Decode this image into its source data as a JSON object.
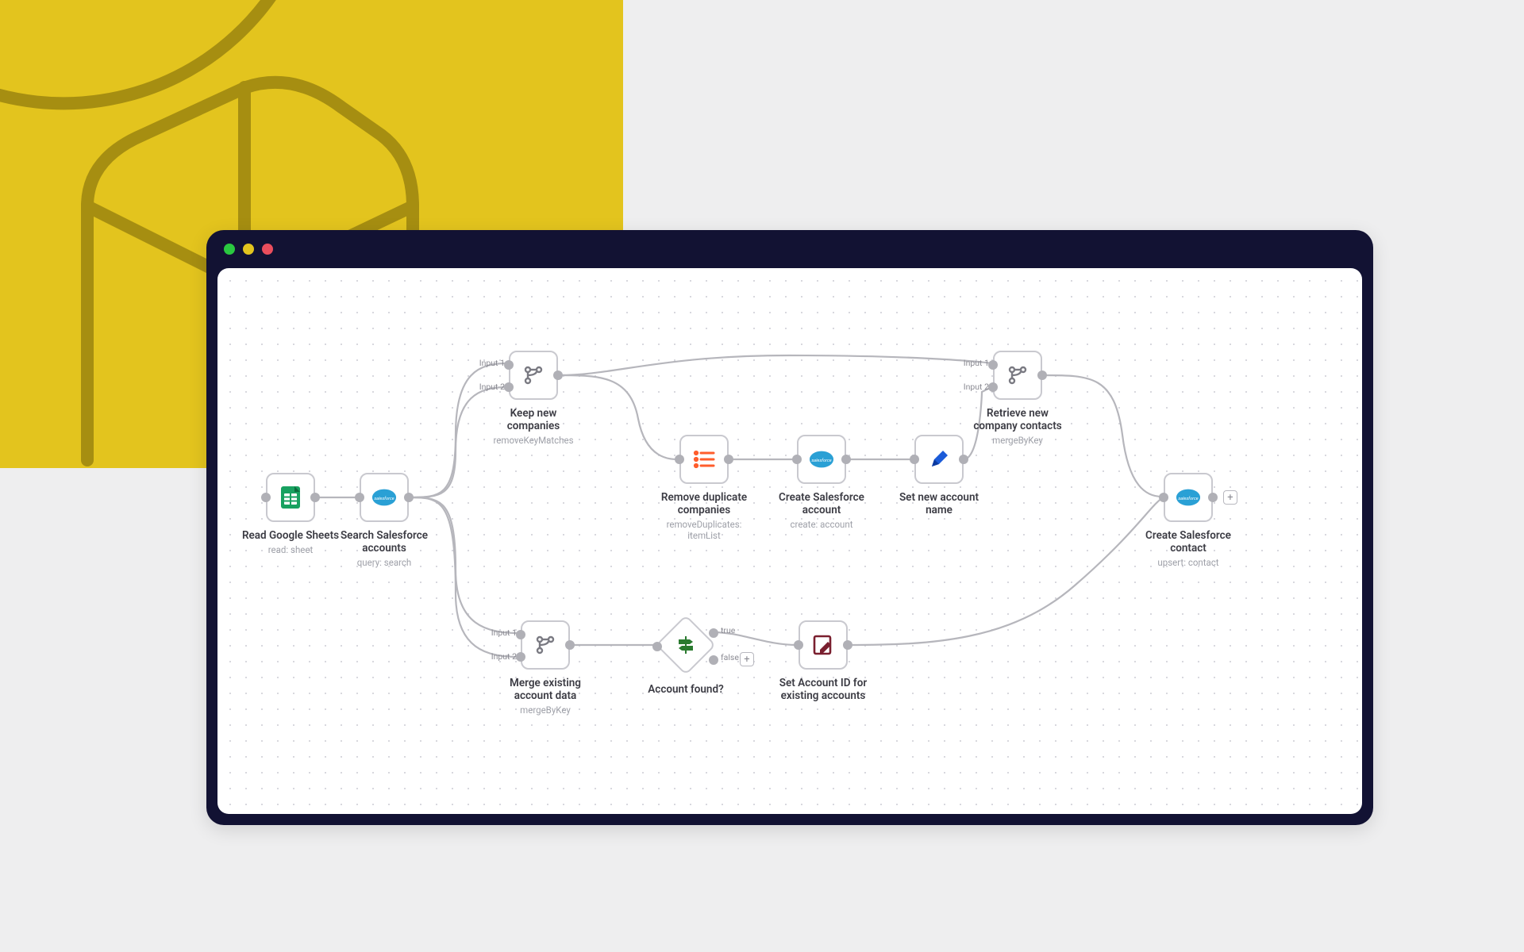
{
  "yellowColor": "#e3c41e",
  "nodes": {
    "readSheets": {
      "title": "Read Google Sheets",
      "sub": "read: sheet"
    },
    "searchSF": {
      "title": "Search Salesforce accounts",
      "sub": "query: search"
    },
    "keepNew": {
      "title": "Keep new companies",
      "sub": "removeKeyMatches"
    },
    "removeDup": {
      "title": "Remove duplicate companies",
      "sub": "removeDuplicates: itemList"
    },
    "createAcc": {
      "title": "Create Salesforce account",
      "sub": "create: account"
    },
    "setName": {
      "title": "Set new account name",
      "sub": ""
    },
    "retrieveNew": {
      "title": "Retrieve new company contacts",
      "sub": "mergeByKey"
    },
    "mergeExist": {
      "title": "Merge existing account data",
      "sub": "mergeByKey"
    },
    "accFound": {
      "title": "Account found?",
      "sub": ""
    },
    "setAccId": {
      "title": "Set Account ID for existing accounts",
      "sub": ""
    },
    "createContact": {
      "title": "Create Salesforce contact",
      "sub": "upsert: contact"
    }
  },
  "labels": {
    "input1": "Input 1",
    "input2": "Input 2",
    "true": "true",
    "false": "false"
  },
  "colors": {
    "googleGreen": "#18a160",
    "salesforceBlue": "#2aa0d5",
    "listOrange": "#ff5d2c",
    "pencilBlue": "#1b5bd8",
    "signpostGreen": "#2a7a2f",
    "editMaroon": "#7a1f2f",
    "branch": "#7a7a82"
  }
}
